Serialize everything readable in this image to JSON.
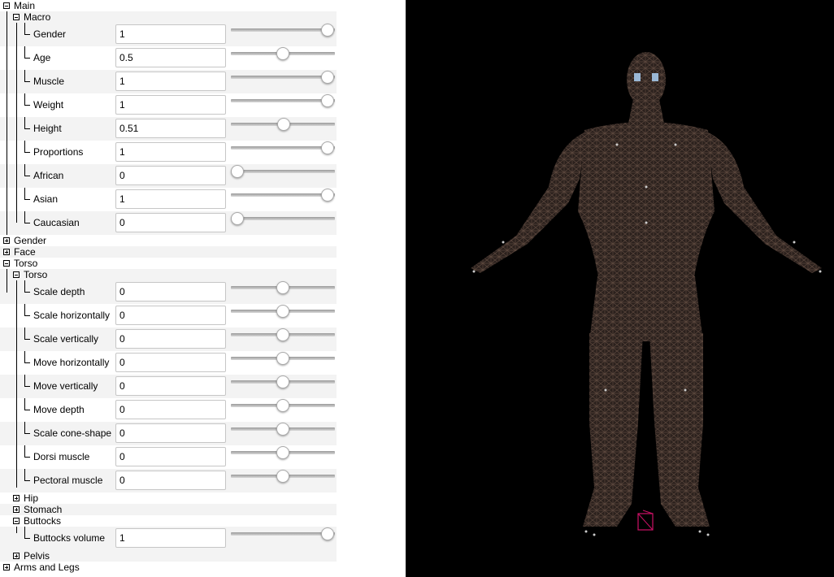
{
  "tree": {
    "main": {
      "label": "Main",
      "expanded": true
    },
    "macro": {
      "label": "Macro",
      "expanded": true,
      "params": [
        {
          "label": "Gender",
          "value": "1",
          "level": 1
        },
        {
          "label": "Age",
          "value": "0.5",
          "level": 0.5
        },
        {
          "label": "Muscle",
          "value": "1",
          "level": 1
        },
        {
          "label": "Weight",
          "value": "1",
          "level": 1
        },
        {
          "label": "Height",
          "value": "0.51",
          "level": 0.51
        },
        {
          "label": "Proportions",
          "value": "1",
          "level": 1
        },
        {
          "label": "African",
          "value": "0",
          "level": 0
        },
        {
          "label": "Asian",
          "value": "1",
          "level": 1
        },
        {
          "label": "Caucasian",
          "value": "0",
          "level": 0
        }
      ]
    },
    "gender": {
      "label": "Gender",
      "expanded": false
    },
    "face": {
      "label": "Face",
      "expanded": false
    },
    "torso_group": {
      "label": "Torso",
      "expanded": true
    },
    "torso": {
      "label": "Torso",
      "expanded": true,
      "params": [
        {
          "label": "Scale depth",
          "value": "0",
          "level": 0.5
        },
        {
          "label": "Scale horizontally",
          "value": "0",
          "level": 0.5
        },
        {
          "label": "Scale vertically",
          "value": "0",
          "level": 0.5
        },
        {
          "label": "Move horizontally",
          "value": "0",
          "level": 0.5
        },
        {
          "label": "Move vertically",
          "value": "0",
          "level": 0.5
        },
        {
          "label": "Move depth",
          "value": "0",
          "level": 0.5
        },
        {
          "label": "Scale cone-shape",
          "value": "0",
          "level": 0.5
        },
        {
          "label": "Dorsi muscle",
          "value": "0",
          "level": 0.5
        },
        {
          "label": "Pectoral muscle",
          "value": "0",
          "level": 0.5
        }
      ]
    },
    "hip": {
      "label": "Hip",
      "expanded": false
    },
    "stomach": {
      "label": "Stomach",
      "expanded": false
    },
    "buttocks": {
      "label": "Buttocks",
      "expanded": true,
      "params": [
        {
          "label": "Buttocks volume",
          "value": "1",
          "level": 1
        }
      ]
    },
    "pelvis": {
      "label": "Pelvis",
      "expanded": false
    },
    "arms_legs": {
      "label": "Arms and Legs",
      "expanded": false
    }
  },
  "viewport": {
    "background": "#000000",
    "mesh_color": "#4a3a33",
    "marker_color": "#cc1166",
    "content": "3d-human-wireframe-model"
  },
  "colors": {
    "row_shade": "#f3f3f3",
    "tree_line": "#000000"
  }
}
